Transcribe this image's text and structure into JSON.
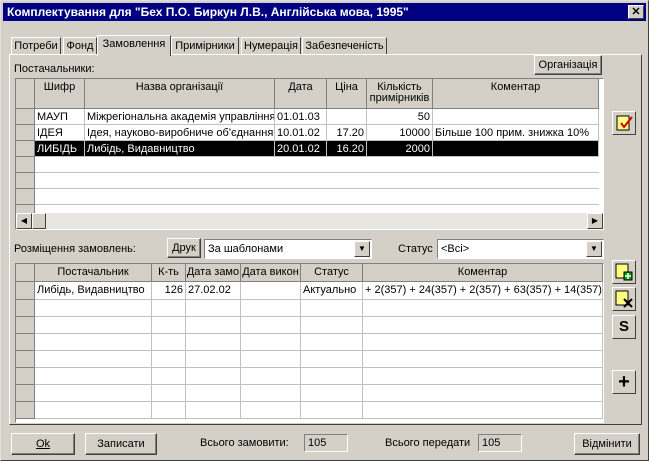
{
  "window": {
    "title": "Комплектування для \"Бех П.О. Биркун Л.В., Англійська мова, 1995\"",
    "close": "✕"
  },
  "tabs": [
    {
      "label": "Потреби"
    },
    {
      "label": "Фонд"
    },
    {
      "label": "Замовлення"
    },
    {
      "label": "Примірники"
    },
    {
      "label": "Нумерація"
    },
    {
      "label": "Забезпеченість"
    }
  ],
  "suppliers": {
    "label": "Постачальники:",
    "org_button": "Організація",
    "columns": [
      "Шифр",
      "Назва організації",
      "Дата",
      "Ціна",
      "Кількість примірників",
      "Коментар"
    ],
    "rows": [
      {
        "code": "МАУП",
        "name": "Міжрегіональна академія управління",
        "date": "01.01.03",
        "price": "",
        "qty": "50",
        "comment": ""
      },
      {
        "code": "ІДЕЯ",
        "name": "Ідея, науково-виробниче об'єднання",
        "date": "10.01.02",
        "price": "17.20",
        "qty": "10000",
        "comment": "Більше 100 прим. знижка 10%"
      },
      {
        "code": "ЛИБІДЬ",
        "name": "Либідь, Видавництво",
        "date": "20.01.02",
        "price": "16.20",
        "qty": "2000",
        "comment": ""
      }
    ]
  },
  "orders": {
    "label": "Розміщення замовлень:",
    "print_button": "Друк",
    "template_select": "За шаблонами",
    "status_label": "Статус",
    "status_select": "<Всі>",
    "columns": [
      "Постачальник",
      "К-ть",
      "Дата замо",
      "Дата викон",
      "Статус",
      "Коментар"
    ],
    "rows": [
      {
        "supplier": "Либідь, Видавництво",
        "qty": "126",
        "date": "27.02.02",
        "done": "",
        "status": "Актуально",
        "comment": "+ 2(357) + 24(357) + 2(357) + 63(357) + 14(357)"
      }
    ]
  },
  "toolbar": {
    "s_label": "S",
    "plus_label": "+"
  },
  "footer": {
    "ok": "Ok",
    "save": "Записати",
    "total_ordered_label": "Всього замовити:",
    "total_ordered": "105",
    "total_transfer_label": "Всього передати",
    "total_transfer": "105",
    "cancel": "Відмінити"
  }
}
